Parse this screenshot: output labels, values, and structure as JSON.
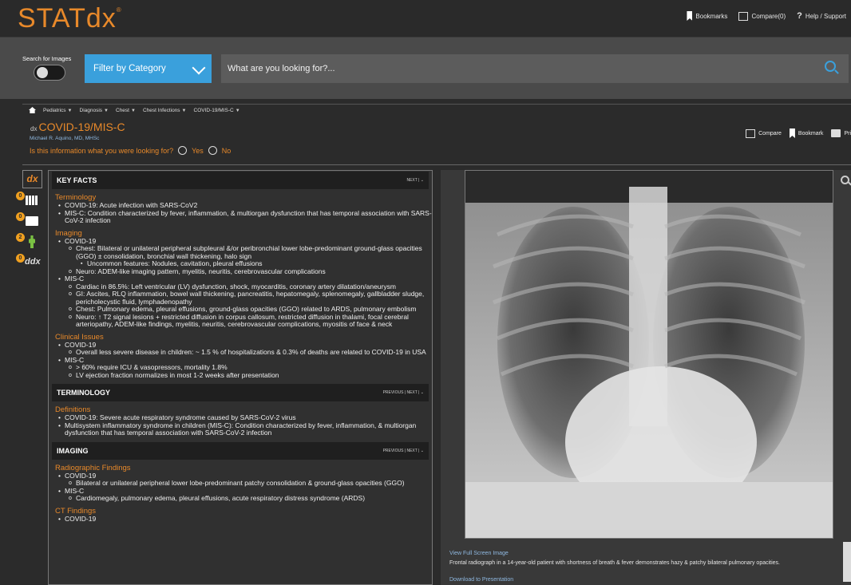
{
  "header": {
    "logo": "STATdx",
    "logo_mark": "®",
    "bookmarks": "Bookmarks",
    "compare": "Compare(0)",
    "help": "Help / Support"
  },
  "search": {
    "search_images_label": "Search for Images",
    "filter_label": "Filter by Category",
    "placeholder": "What are you looking for?..."
  },
  "breadcrumb": [
    "Pediatrics",
    "Diagnosis",
    "Chest",
    "Chest Infections",
    "COVID-19/MIS-C"
  ],
  "topic": {
    "title": "COVID-19/MIS-C",
    "title_prefix": "dx",
    "author": "Michael R. Aquino, MD, MHSc",
    "question": "Is this information what you were looking for?",
    "yes": "Yes",
    "no": "No",
    "compare": "Compare",
    "bookmark": "Bookmark",
    "print": "Pri"
  },
  "sidebar": {
    "dx": "dx",
    "badges": [
      "0",
      "0",
      "2",
      "0"
    ],
    "ddx": "ddx"
  },
  "key_facts": {
    "heading": "KEY FACTS",
    "nav": "NEXT | ⌄",
    "terminology_title": "Terminology",
    "terminology": [
      "COVID-19: Acute infection with SARS-CoV2",
      "MIS-C: Condition characterized by fever, inflammation, & multiorgan dysfunction that has temporal association with SARS-CoV-2 infection"
    ],
    "imaging_title": "Imaging",
    "covid": "COVID-19",
    "covid_chest": "Chest: Bilateral or unilateral peripheral subpleural &/or peribronchial lower lobe-predominant ground-glass opacities (GGO) ± consolidation, bronchial wall thickening, halo sign",
    "covid_uncommon": "Uncommon features: Nodules, cavitation, pleural effusions",
    "covid_neuro": "Neuro: ADEM-like imaging pattern, myelitis, neuritis, cerebrovascular complications",
    "misc": "MIS-C",
    "misc_items": [
      "Cardiac in 86.5%: Left ventricular (LV) dysfunction, shock, myocarditis, coronary artery dilatation/aneurysm",
      "GI: Ascites, RLQ inflammation, bowel wall thickening, pancreatitis, hepatomegaly, splenomegaly, gallbladder sludge, pericholecystic fluid, lymphadenopathy",
      "Chest: Pulmonary edema, pleural effusions, ground-glass opacities (GGO) related to ARDS, pulmonary embolism",
      "Neuro: ↑ T2 signal lesions + restricted diffusion in corpus callosum, restricted diffusion in thalami, focal cerebral arteriopathy, ADEM-like findings, myelitis, neuritis, cerebrovascular complications, myositis of face & neck"
    ],
    "clinical_title": "Clinical Issues",
    "clinical_covid": "COVID-19",
    "clinical_covid_item": "Overall less severe disease in children: ~ 1.5 % of hospitalizations & 0.3% of deaths are related to COVID-19 in USA",
    "clinical_misc": "MIS-C",
    "clinical_misc_items": [
      "> 60% require ICU & vasopressors, mortality 1.8%",
      "LV ejection fraction normalizes in most 1-2 weeks after presentation"
    ]
  },
  "terminology": {
    "heading": "TERMINOLOGY",
    "nav": "PREVIOUS | NEXT | ⌄",
    "definitions_title": "Definitions",
    "items": [
      "COVID-19: Severe acute respiratory syndrome caused by SARS-CoV-2 virus",
      "Multisystem inflammatory syndrome in children (MIS-C): Condition characterized by fever, inflammation, & multiorgan dysfunction that has temporal association with SARS-CoV-2 infection"
    ]
  },
  "imaging": {
    "heading": "IMAGING",
    "nav": "PREVIOUS | NEXT | ⌄",
    "radiographic_title": "Radiographic Findings",
    "covid": "COVID-19",
    "covid_item": "Bilateral or unilateral peripheral lower lobe-predominant patchy consolidation & ground-glass opacities (GGO)",
    "misc": "MIS-C",
    "misc_item": "Cardiomegaly, pulmonary edema, pleural effusions, acute respiratory distress syndrome (ARDS)",
    "ct_title": "CT Findings",
    "ct_covid": "COVID-19"
  },
  "image_panel": {
    "view_full": "View Full Screen Image",
    "caption": "Frontal radiograph in a 14-year-old patient with shortness of breath & fever demonstrates hazy & patchy bilateral pulmonary opacities.",
    "download": "Download to Presentation"
  }
}
